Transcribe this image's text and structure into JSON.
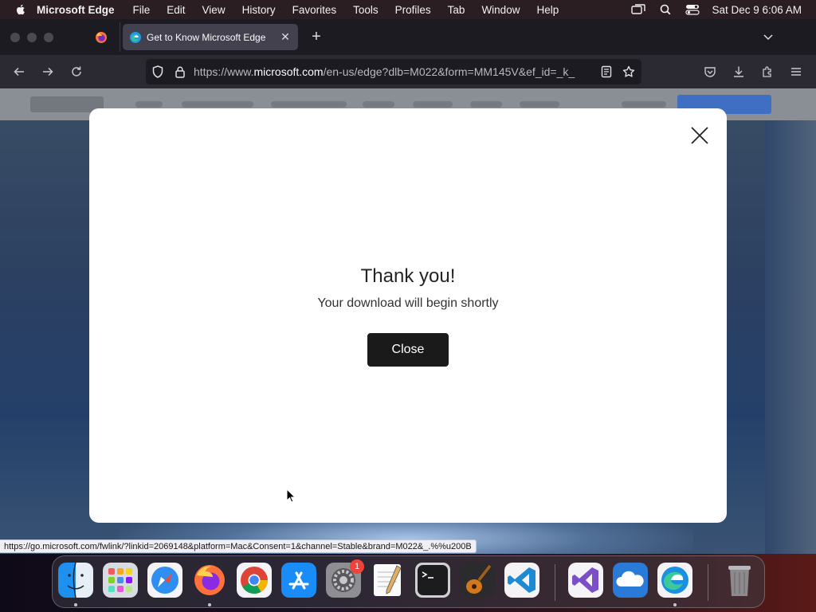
{
  "menubar": {
    "app_name": "Microsoft Edge",
    "items": [
      "File",
      "Edit",
      "View",
      "History",
      "Favorites",
      "Tools",
      "Profiles",
      "Tab",
      "Window",
      "Help"
    ],
    "clock": "Sat Dec 9  6:06 AM"
  },
  "browser": {
    "active_tab_title": "Get to Know Microsoft Edge",
    "url_prefix": "https://www.",
    "url_domain": "microsoft.com",
    "url_rest": "/en-us/edge?dlb=M022&form=MM145V&ef_id=_k_"
  },
  "modal": {
    "title": "Thank you!",
    "subtitle": "Your download will begin shortly",
    "button_label": "Close"
  },
  "status_url": "https://go.microsoft.com/fwlink/?linkid=2069148&platform=Mac&Consent=1&channel=Stable&brand=M022&_.%%u200B",
  "dock": {
    "apps": [
      {
        "name": "finder-icon",
        "running": true
      },
      {
        "name": "launchpad-icon",
        "running": false
      },
      {
        "name": "safari-icon",
        "running": false
      },
      {
        "name": "firefox-icon",
        "running": true
      },
      {
        "name": "chrome-icon",
        "running": false
      },
      {
        "name": "app-store-icon",
        "running": false
      },
      {
        "name": "system-settings-icon",
        "running": false,
        "badge": "1"
      },
      {
        "name": "textedit-icon",
        "running": false
      },
      {
        "name": "terminal-icon",
        "running": false
      },
      {
        "name": "garageband-icon",
        "running": false
      },
      {
        "name": "vscode-icon",
        "running": false
      },
      {
        "name": "visual-studio-icon",
        "running": false
      },
      {
        "name": "onedrive-icon",
        "running": false
      },
      {
        "name": "edge-icon",
        "running": true
      },
      {
        "name": "trash-icon",
        "running": false
      }
    ]
  },
  "colors": {
    "modal_button": "#1a1a1a",
    "status_bar_bg": "#f0f0f4",
    "badge": "#f0413b"
  }
}
